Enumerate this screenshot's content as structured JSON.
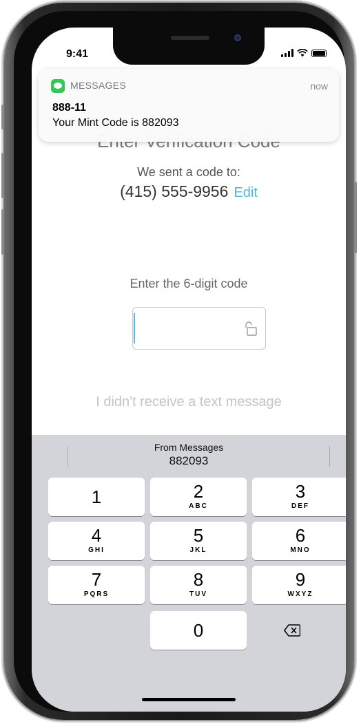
{
  "status_bar": {
    "time": "9:41"
  },
  "page": {
    "heading": "Enter Verification Code",
    "sent_label": "We sent a code to:",
    "phone_number": "(415) 555-9956",
    "edit_label": "Edit",
    "enter_label": "Enter the 6-digit code",
    "code_value": "",
    "no_text_link": "I didn't receive a text message"
  },
  "notification": {
    "app": "MESSAGES",
    "time": "now",
    "sender": "888-11",
    "body": "Your Mint Code is 882093"
  },
  "keyboard": {
    "suggestion_label": "From Messages",
    "suggestion_code": "882093",
    "keys": [
      {
        "num": "1",
        "letters": ""
      },
      {
        "num": "2",
        "letters": "ABC"
      },
      {
        "num": "3",
        "letters": "DEF"
      },
      {
        "num": "4",
        "letters": "GHI"
      },
      {
        "num": "5",
        "letters": "JKL"
      },
      {
        "num": "6",
        "letters": "MNO"
      },
      {
        "num": "7",
        "letters": "PQRS"
      },
      {
        "num": "8",
        "letters": "TUV"
      },
      {
        "num": "9",
        "letters": "WXYZ"
      },
      {
        "num": "0",
        "letters": ""
      }
    ],
    "delete_icon": "backspace-icon"
  },
  "colors": {
    "accent": "#55b7de",
    "keyboard_bg": "#d2d4d9",
    "messages_green": "#35c759"
  }
}
